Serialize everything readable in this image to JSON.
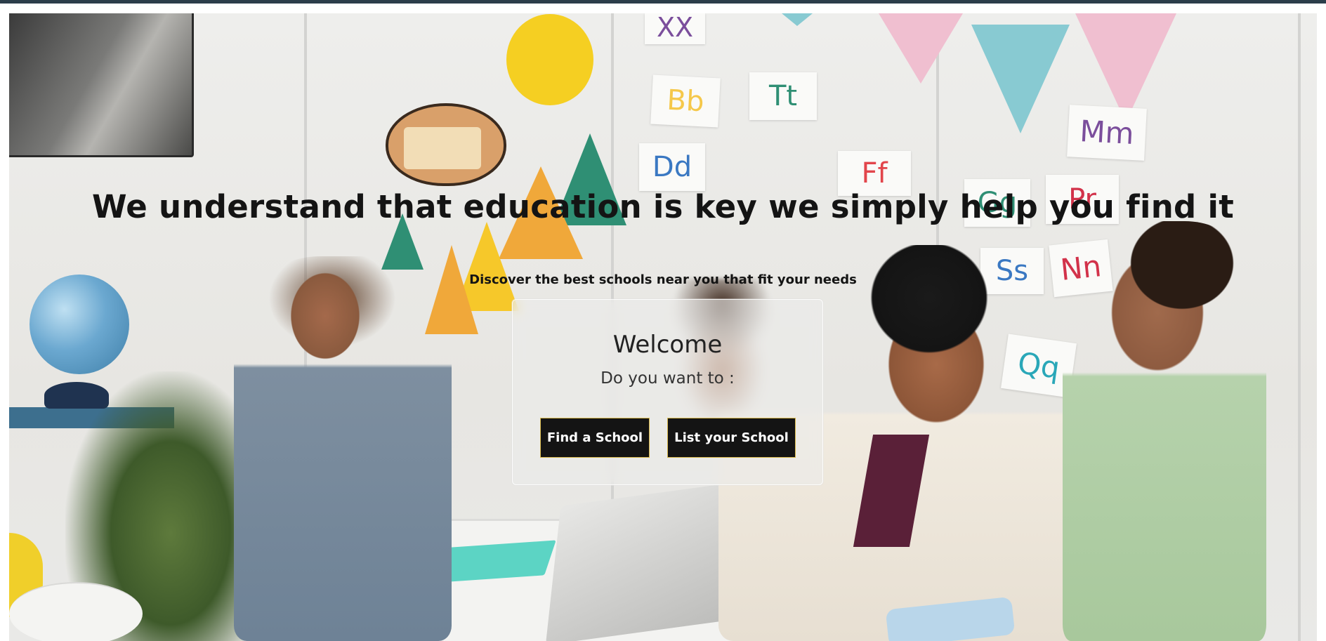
{
  "hero": {
    "headline": "We understand that education is key we simply help you find it",
    "subline": "Discover the best schools near you that fit your needs"
  },
  "welcome": {
    "title": "Welcome",
    "subtitle": "Do you want to :",
    "find_label": "Find a School",
    "list_label": "List your School"
  },
  "scene": {
    "letter_cards": [
      "XX",
      "Bb",
      "Tt",
      "Dd",
      "Ff",
      "Mm",
      "Qq",
      "Ss",
      "Nn",
      "Pr",
      "Gg"
    ]
  },
  "colors": {
    "top_bar": "#2c3e4a",
    "button_bg": "#141414",
    "button_border": "#d8b84a",
    "headline": "#141414"
  }
}
